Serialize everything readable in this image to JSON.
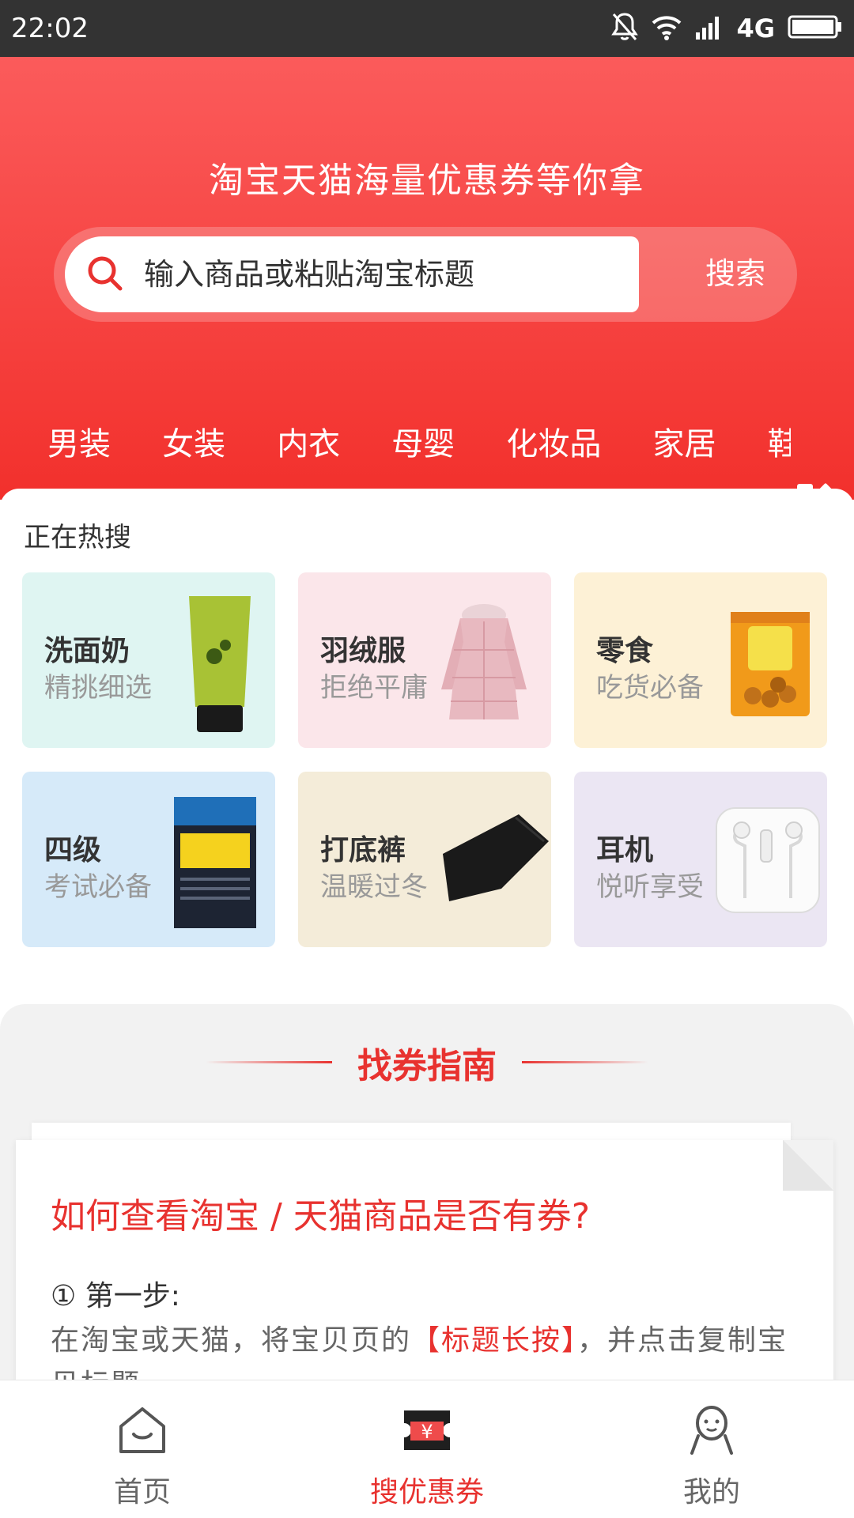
{
  "status_bar": {
    "time": "22:02",
    "network": "4G"
  },
  "header": {
    "slogan": "淘宝天猫海量优惠券等你拿",
    "search_placeholder": "输入商品或粘贴淘宝标题",
    "search_button": "搜索"
  },
  "categories": [
    "男装",
    "女装",
    "内衣",
    "母婴",
    "化妆品",
    "家居",
    "鞋包"
  ],
  "hot": {
    "title": "正在热搜",
    "items": [
      {
        "title": "洗面奶",
        "subtitle": "精挑细选",
        "bg": "#dff5f2"
      },
      {
        "title": "羽绒服",
        "subtitle": "拒绝平庸",
        "bg": "#fbe6ea"
      },
      {
        "title": "零食",
        "subtitle": "吃货必备",
        "bg": "#fdf1d6"
      },
      {
        "title": "四级",
        "subtitle": "考试必备",
        "bg": "#d6eaf9"
      },
      {
        "title": "打底裤",
        "subtitle": "温暖过冬",
        "bg": "#f4ecd9"
      },
      {
        "title": "耳机",
        "subtitle": "悦听享受",
        "bg": "#ebe6f3"
      }
    ]
  },
  "guide": {
    "title": "找券指南",
    "question": "如何查看淘宝 / 天猫商品是否有券?",
    "step": "① 第一步:",
    "desc_prefix": "在淘宝或天猫，将宝贝页的",
    "desc_highlight": "【标题长按】",
    "desc_suffix": "，并点击复制宝贝标题"
  },
  "tabbar": {
    "home": "首页",
    "coupon": "搜优惠券",
    "mine": "我的"
  },
  "colors": {
    "brand_red": "#e8322f",
    "header_top": "#fb5b5b",
    "header_bottom": "#f2302c"
  }
}
